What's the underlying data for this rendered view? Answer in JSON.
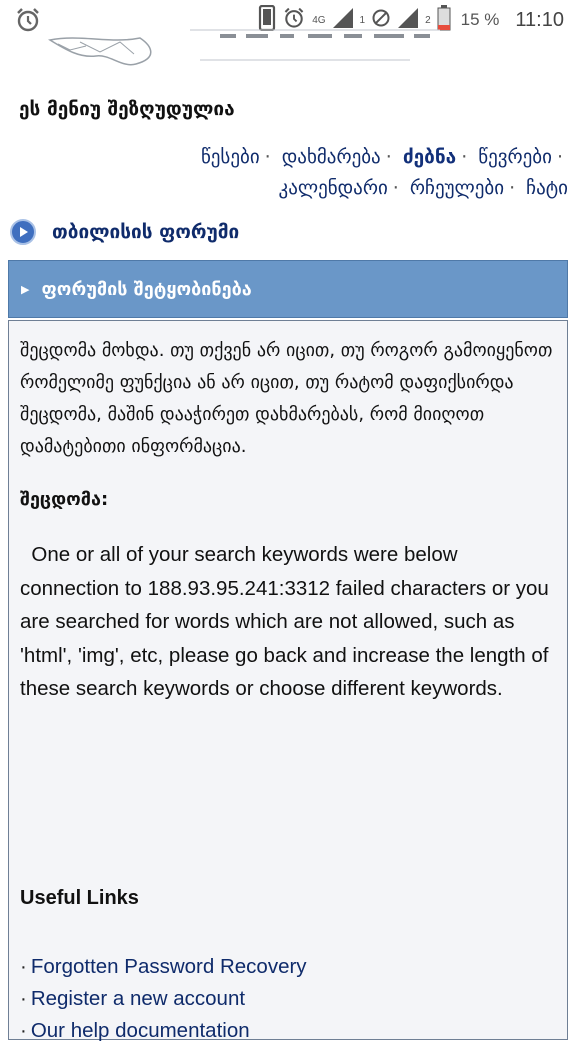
{
  "status_bar": {
    "network": "4G",
    "sim1": "1",
    "sim2": "2",
    "battery": "15 %",
    "time": "11:10",
    "icons": [
      "alarm-icon",
      "phone-icon",
      "alarm-icon",
      "signal-icon",
      "no-signal-icon",
      "signal-icon",
      "battery-icon"
    ]
  },
  "header": {
    "menu_notice": "ეს მენიუ შეზღუდულია"
  },
  "nav": {
    "items": [
      {
        "label": "წესები",
        "active": false
      },
      {
        "label": "დახმარება",
        "active": false
      },
      {
        "label": "ძებნა",
        "active": true
      },
      {
        "label": "წევრები",
        "active": false
      },
      {
        "label": "კალენდარი",
        "active": false
      },
      {
        "label": "რჩეულები",
        "active": false
      },
      {
        "label": "ჩატი",
        "active": false
      }
    ]
  },
  "forum": {
    "title": "თბილისის ფორუმი"
  },
  "panel": {
    "title": "ფორუმის შეტყობინება",
    "message": "შეცდომა მოხდა. თუ თქვენ არ იცით, თუ როგორ გამოიყენოთ რომელიმე ფუნქცია ან არ იცით, თუ რატომ დაფიქსირდა შეცდომა, მაშინ დააჭირეთ დახმარებას, რომ მიიღოთ დამატებითი ინფორმაცია.",
    "error_label": "შეცდომა:",
    "error_text": "One or all of your search keywords were below connection to 188.93.95.241:3312 failed characters or you are searched for words which are not allowed, such as 'html', 'img', etc, please go back and increase the length of these search keywords or choose different keywords.",
    "useful_links_title": "Useful Links",
    "links": [
      "Forgotten Password Recovery",
      "Register a new account",
      "Our help documentation"
    ]
  },
  "colors": {
    "panel_header": "#6a97c8",
    "link": "#0f2b6b",
    "panel_body": "#f4f5f8"
  }
}
